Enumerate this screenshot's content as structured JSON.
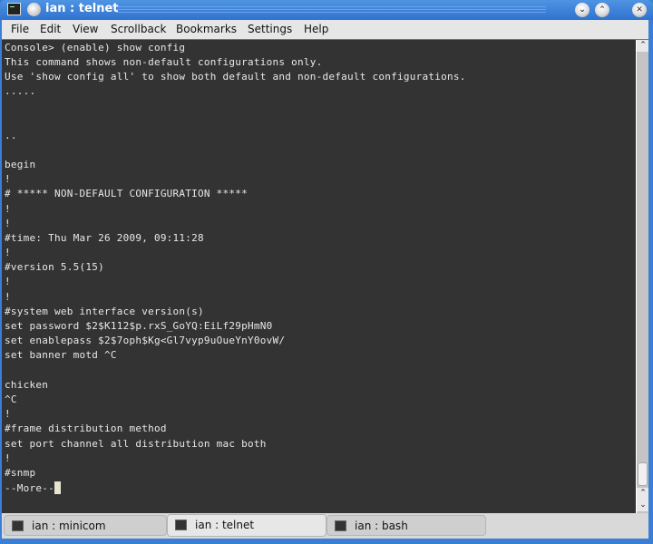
{
  "window": {
    "title": "ian : telnet",
    "buttons": {
      "minimize": "⌄",
      "maximize": "⌃",
      "close": "✕"
    },
    "colors": {
      "titlebar": "#3a7fd6",
      "terminal_bg": "#333333",
      "terminal_fg": "#e8e8e8"
    }
  },
  "menubar": {
    "items": [
      "File",
      "Edit",
      "View",
      "Scrollback",
      "Bookmarks",
      "Settings",
      "Help"
    ]
  },
  "terminal": {
    "lines": [
      "Console> (enable) show config",
      "This command shows non-default configurations only.",
      "Use 'show config all' to show both default and non-default configurations.",
      ".....",
      "",
      "",
      "..",
      "",
      "begin",
      "!",
      "# ***** NON-DEFAULT CONFIGURATION *****",
      "!",
      "!",
      "#time: Thu Mar 26 2009, 09:11:28",
      "!",
      "#version 5.5(15)",
      "!",
      "!",
      "#system web interface version(s)",
      "set password $2$K112$p.rxS_GoYQ:EiLf29pHmN0",
      "set enablepass $2$7oph$Kg<Gl7vyp9uOueYnY0ovW/",
      "set banner motd ^C",
      "",
      "chicken",
      "^C",
      "!",
      "#frame distribution method",
      "set port channel all distribution mac both",
      "!",
      "#snmp",
      "--More--"
    ]
  },
  "scrollbar": {
    "up": "⌃",
    "down": "⌄",
    "position": 0.98
  },
  "tabs": [
    {
      "label": "ian : minicom",
      "active": false
    },
    {
      "label": "ian : telnet",
      "active": true
    },
    {
      "label": "ian : bash",
      "active": false
    }
  ]
}
